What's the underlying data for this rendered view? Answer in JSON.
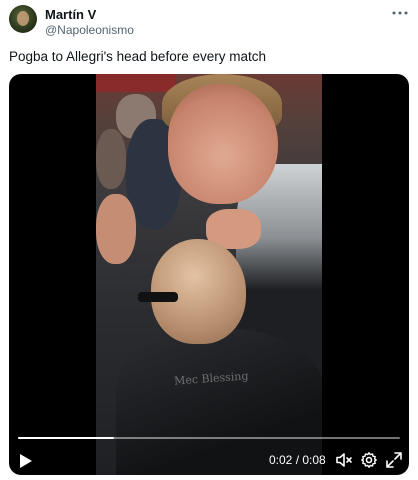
{
  "tweet": {
    "display_name": "Martín V",
    "handle": "@Napoleonismo",
    "more_icon": "more-horizontal-icon",
    "text": "Pogba to Allegri's head before every match"
  },
  "video": {
    "watermark": "Mec Blessing",
    "time_display": "0:02 / 0:08",
    "progress": 0.25,
    "controls": {
      "play_icon": "play-icon",
      "mute_icon": "volume-muted-icon",
      "settings_icon": "gear-icon",
      "fullscreen_icon": "fullscreen-icon"
    }
  }
}
